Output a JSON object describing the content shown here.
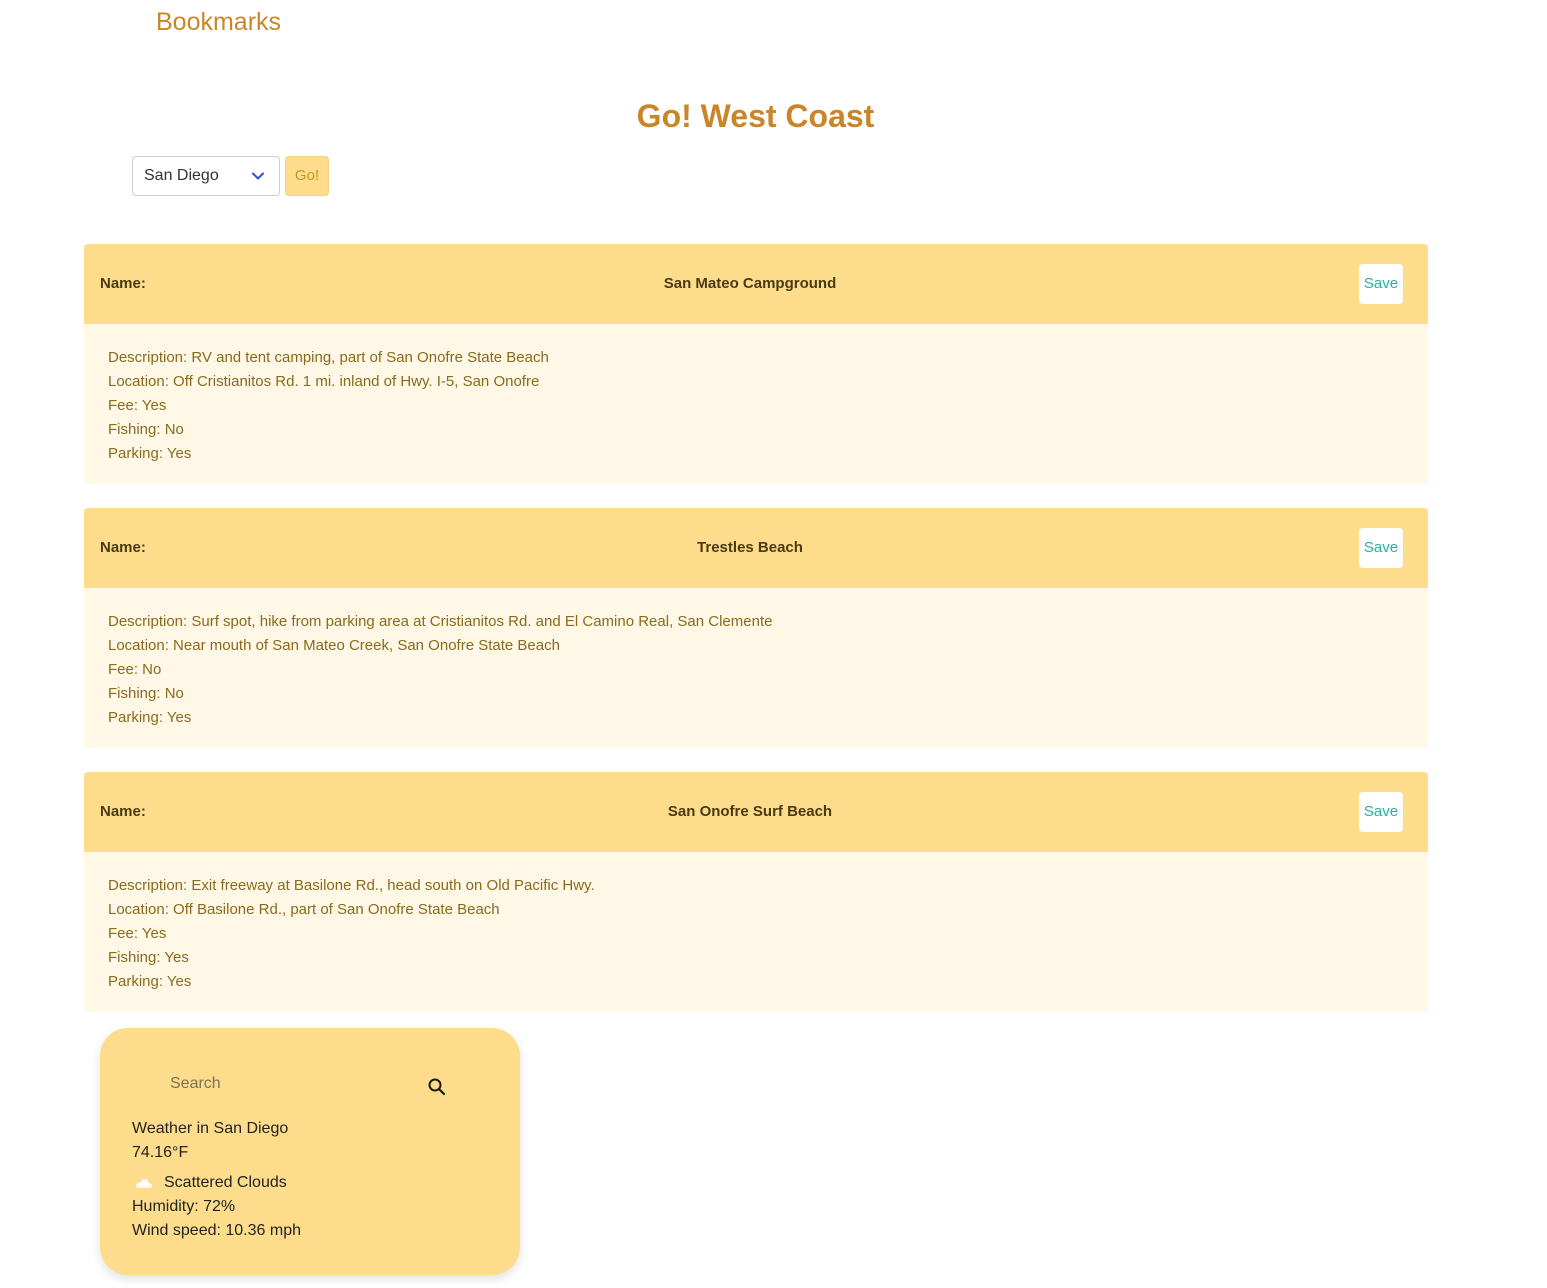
{
  "nav": {
    "bookmarks_link": "Bookmarks"
  },
  "header": {
    "title": "Go! West Coast"
  },
  "city_picker": {
    "selected_city": "San Diego",
    "go_label": "Go!",
    "icon": "chevron-down-icon"
  },
  "places": [
    {
      "name_label": "Name:",
      "name": "San Mateo Campground",
      "save_label": "Save",
      "description": "Description: RV and tent camping, part of San Onofre State Beach",
      "location": "Location: Off Cristianitos Rd. 1 mi. inland of Hwy. I-5, San Onofre",
      "fee": "Fee: Yes",
      "fishing": "Fishing: No",
      "parking": "Parking: Yes"
    },
    {
      "name_label": "Name:",
      "name": "Trestles Beach",
      "save_label": "Save",
      "description": "Description: Surf spot, hike from parking area at Cristianitos Rd. and El Camino Real, San Clemente",
      "location": "Location: Near mouth of San Mateo Creek, San Onofre State Beach",
      "fee": "Fee: No",
      "fishing": "Fishing: No",
      "parking": "Parking: Yes"
    },
    {
      "name_label": "Name:",
      "name": "San Onofre Surf Beach",
      "save_label": "Save",
      "description": "Description: Exit freeway at Basilone Rd., head south on Old Pacific Hwy.",
      "location": "Location: Off Basilone Rd., part of San Onofre State Beach",
      "fee": "Fee: Yes",
      "fishing": "Fishing: Yes",
      "parking": "Parking: Yes"
    }
  ],
  "weather": {
    "search_placeholder": "Search",
    "search_icon": "search-icon",
    "city_line": "Weather in San Diego",
    "temperature": "74.16°F",
    "condition_icon": "cloud-icon",
    "condition": "Scattered Clouds",
    "humidity": "Humidity: 72%",
    "wind": "Wind speed: 10.36 mph"
  },
  "colors": {
    "accent": "#c98628",
    "card_header": "#fddd8b",
    "card_body": "#fff8e7",
    "save_text": "#22b3a6",
    "body_text": "#8a6a1c"
  }
}
